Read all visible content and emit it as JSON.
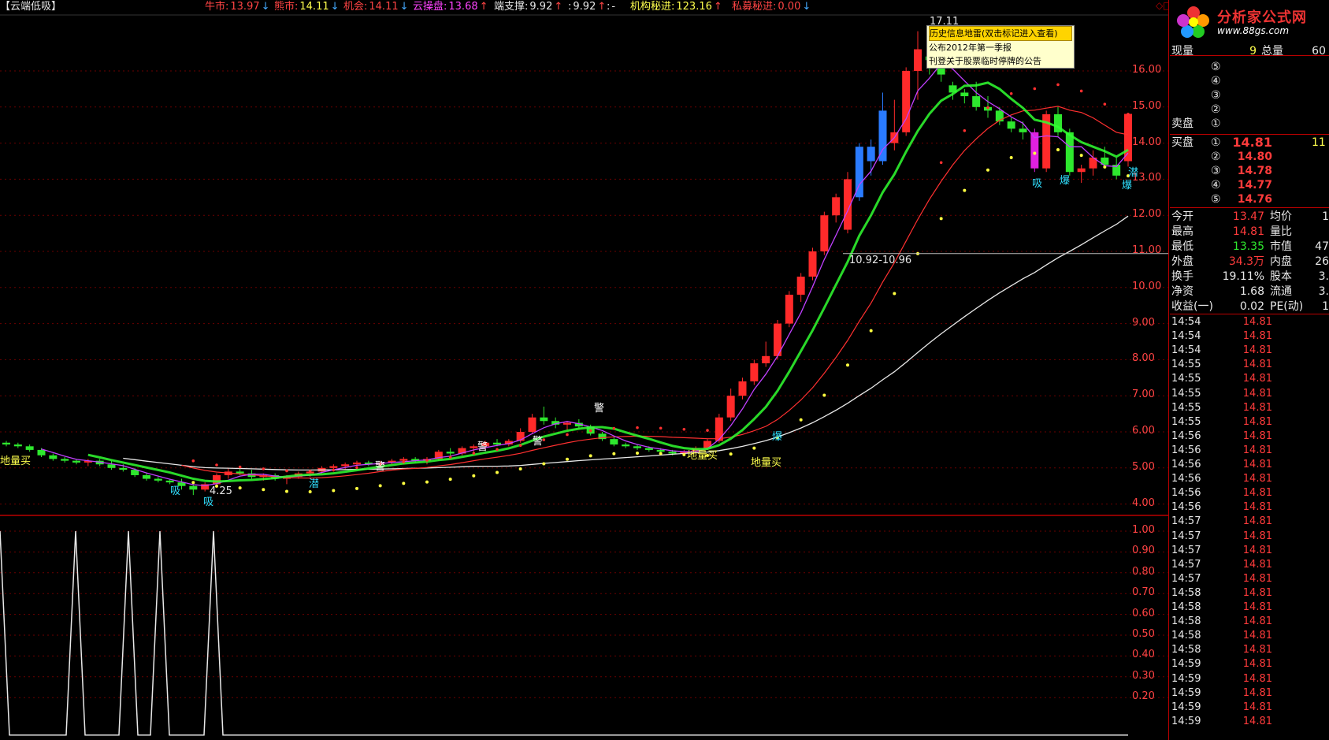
{
  "header": {
    "title": "【云端低吸】",
    "indicators": [
      {
        "label": "牛市:",
        "value": "13.97",
        "arrow": "↓",
        "color": "#ff4444",
        "vcolor": "#ff4444"
      },
      {
        "label": "熊市:",
        "value": "14.11",
        "arrow": "↓",
        "color": "#ff4444",
        "vcolor": "#ffff4d"
      },
      {
        "label": "机会:",
        "value": "14.11",
        "arrow": "↓",
        "color": "#ff4444",
        "vcolor": "#ff4444"
      },
      {
        "label": "云操盘:",
        "value": "13.68",
        "arrow": "↑",
        "color": "#ff44ff",
        "vcolor": "#ff44ff"
      },
      {
        "label": "端支撑:",
        "value": "9.92",
        "arrow": "↑",
        "color": "#e8e8e8",
        "vcolor": "#e8e8e8"
      },
      {
        "label": ":",
        "value": "9.92",
        "arrow": "↑",
        "color": "#e8e8e8",
        "vcolor": "#e8e8e8"
      },
      {
        "label": ":",
        "value": "-",
        "arrow": "",
        "color": "#e8e8e8",
        "vcolor": "#e8e8e8"
      },
      {
        "label": "机构秘进:",
        "value": "123.16",
        "arrow": "↑",
        "color": "#ffff4d",
        "vcolor": "#ffff4d"
      },
      {
        "label": "私募秘进:",
        "value": "0.00",
        "arrow": "↓",
        "color": "#ff4444",
        "vcolor": "#ff4444"
      }
    ]
  },
  "popup": {
    "title": "历史信息地雷(双击标记进入查看)",
    "lines": [
      "公布2012年第一季报",
      "刊登关于股票临时停牌的公告"
    ]
  },
  "price_axis": [
    "16.00",
    "15.00",
    "14.00",
    "13.00",
    "12.00",
    "11.00",
    "10.00",
    "9.00",
    "8.00",
    "7.00",
    "6.00",
    "5.00",
    "4.00"
  ],
  "sub_axis": [
    "1.00",
    "0.90",
    "0.80",
    "0.70",
    "0.60",
    "0.50",
    "0.40",
    "0.30",
    "0.20"
  ],
  "annotations": {
    "range_label": "10.92-10.96",
    "low_label": "4.25",
    "peak_label": "17.11",
    "markers": [
      "地量买",
      "吸",
      "吸",
      "潜",
      "警",
      "警",
      "警",
      "警",
      "地量买",
      "地量买",
      "爆",
      "吸",
      "爆",
      "爆",
      "潜"
    ]
  },
  "logo": {
    "name": "分析家公式网",
    "url": "www.88gs.com"
  },
  "side": {
    "xianliang_label": "现量",
    "xianliang": "9",
    "zongliang_label": "总量",
    "zongliang": "60",
    "sell_label": "卖盘",
    "buy_label": "买盘",
    "sell": [
      {
        "n": "⑤",
        "p": "",
        "v": ""
      },
      {
        "n": "④",
        "p": "",
        "v": ""
      },
      {
        "n": "③",
        "p": "",
        "v": ""
      },
      {
        "n": "②",
        "p": "",
        "v": ""
      },
      {
        "n": "①",
        "p": "",
        "v": ""
      }
    ],
    "buy": [
      {
        "n": "①",
        "p": "14.81",
        "v": "11"
      },
      {
        "n": "②",
        "p": "14.80",
        "v": ""
      },
      {
        "n": "③",
        "p": "14.78",
        "v": ""
      },
      {
        "n": "④",
        "p": "14.77",
        "v": ""
      },
      {
        "n": "⑤",
        "p": "14.76",
        "v": ""
      }
    ],
    "stats": [
      {
        "a": "今开",
        "av": "13.47",
        "ac": "red",
        "b": "均价",
        "bv": "1"
      },
      {
        "a": "最高",
        "av": "14.81",
        "ac": "red",
        "b": "量比",
        "bv": ""
      },
      {
        "a": "最低",
        "av": "13.35",
        "ac": "grn",
        "b": "市值",
        "bv": "47"
      },
      {
        "a": "外盘",
        "av": "34.3万",
        "ac": "red",
        "b": "内盘",
        "bv": "26"
      },
      {
        "a": "换手",
        "av": "19.11%",
        "ac": "wht",
        "b": "股本",
        "bv": "3."
      },
      {
        "a": "净资",
        "av": "1.68",
        "ac": "wht",
        "b": "流通",
        "bv": "3."
      },
      {
        "a": "收益(一)",
        "av": "0.02",
        "ac": "wht",
        "b": "PE(动)",
        "bv": "1"
      }
    ],
    "ticks": [
      {
        "t": "14:54",
        "p": "14.81"
      },
      {
        "t": "14:54",
        "p": "14.81"
      },
      {
        "t": "14:54",
        "p": "14.81"
      },
      {
        "t": "14:55",
        "p": "14.81"
      },
      {
        "t": "14:55",
        "p": "14.81"
      },
      {
        "t": "14:55",
        "p": "14.81"
      },
      {
        "t": "14:55",
        "p": "14.81"
      },
      {
        "t": "14:55",
        "p": "14.81"
      },
      {
        "t": "14:56",
        "p": "14.81"
      },
      {
        "t": "14:56",
        "p": "14.81"
      },
      {
        "t": "14:56",
        "p": "14.81"
      },
      {
        "t": "14:56",
        "p": "14.81"
      },
      {
        "t": "14:56",
        "p": "14.81"
      },
      {
        "t": "14:56",
        "p": "14.81"
      },
      {
        "t": "14:57",
        "p": "14.81"
      },
      {
        "t": "14:57",
        "p": "14.81"
      },
      {
        "t": "14:57",
        "p": "14.81"
      },
      {
        "t": "14:57",
        "p": "14.81"
      },
      {
        "t": "14:57",
        "p": "14.81"
      },
      {
        "t": "14:58",
        "p": "14.81"
      },
      {
        "t": "14:58",
        "p": "14.81"
      },
      {
        "t": "14:58",
        "p": "14.81"
      },
      {
        "t": "14:58",
        "p": "14.81"
      },
      {
        "t": "14:58",
        "p": "14.81"
      },
      {
        "t": "14:59",
        "p": "14.81"
      },
      {
        "t": "14:59",
        "p": "14.81"
      },
      {
        "t": "14:59",
        "p": "14.81"
      },
      {
        "t": "14:59",
        "p": "14.81"
      },
      {
        "t": "14:59",
        "p": "14.81"
      }
    ]
  },
  "colors": {
    "up": "#ff2a2a",
    "down": "#2ee82e",
    "bg": "#000000",
    "grid": "#8b0000"
  }
}
